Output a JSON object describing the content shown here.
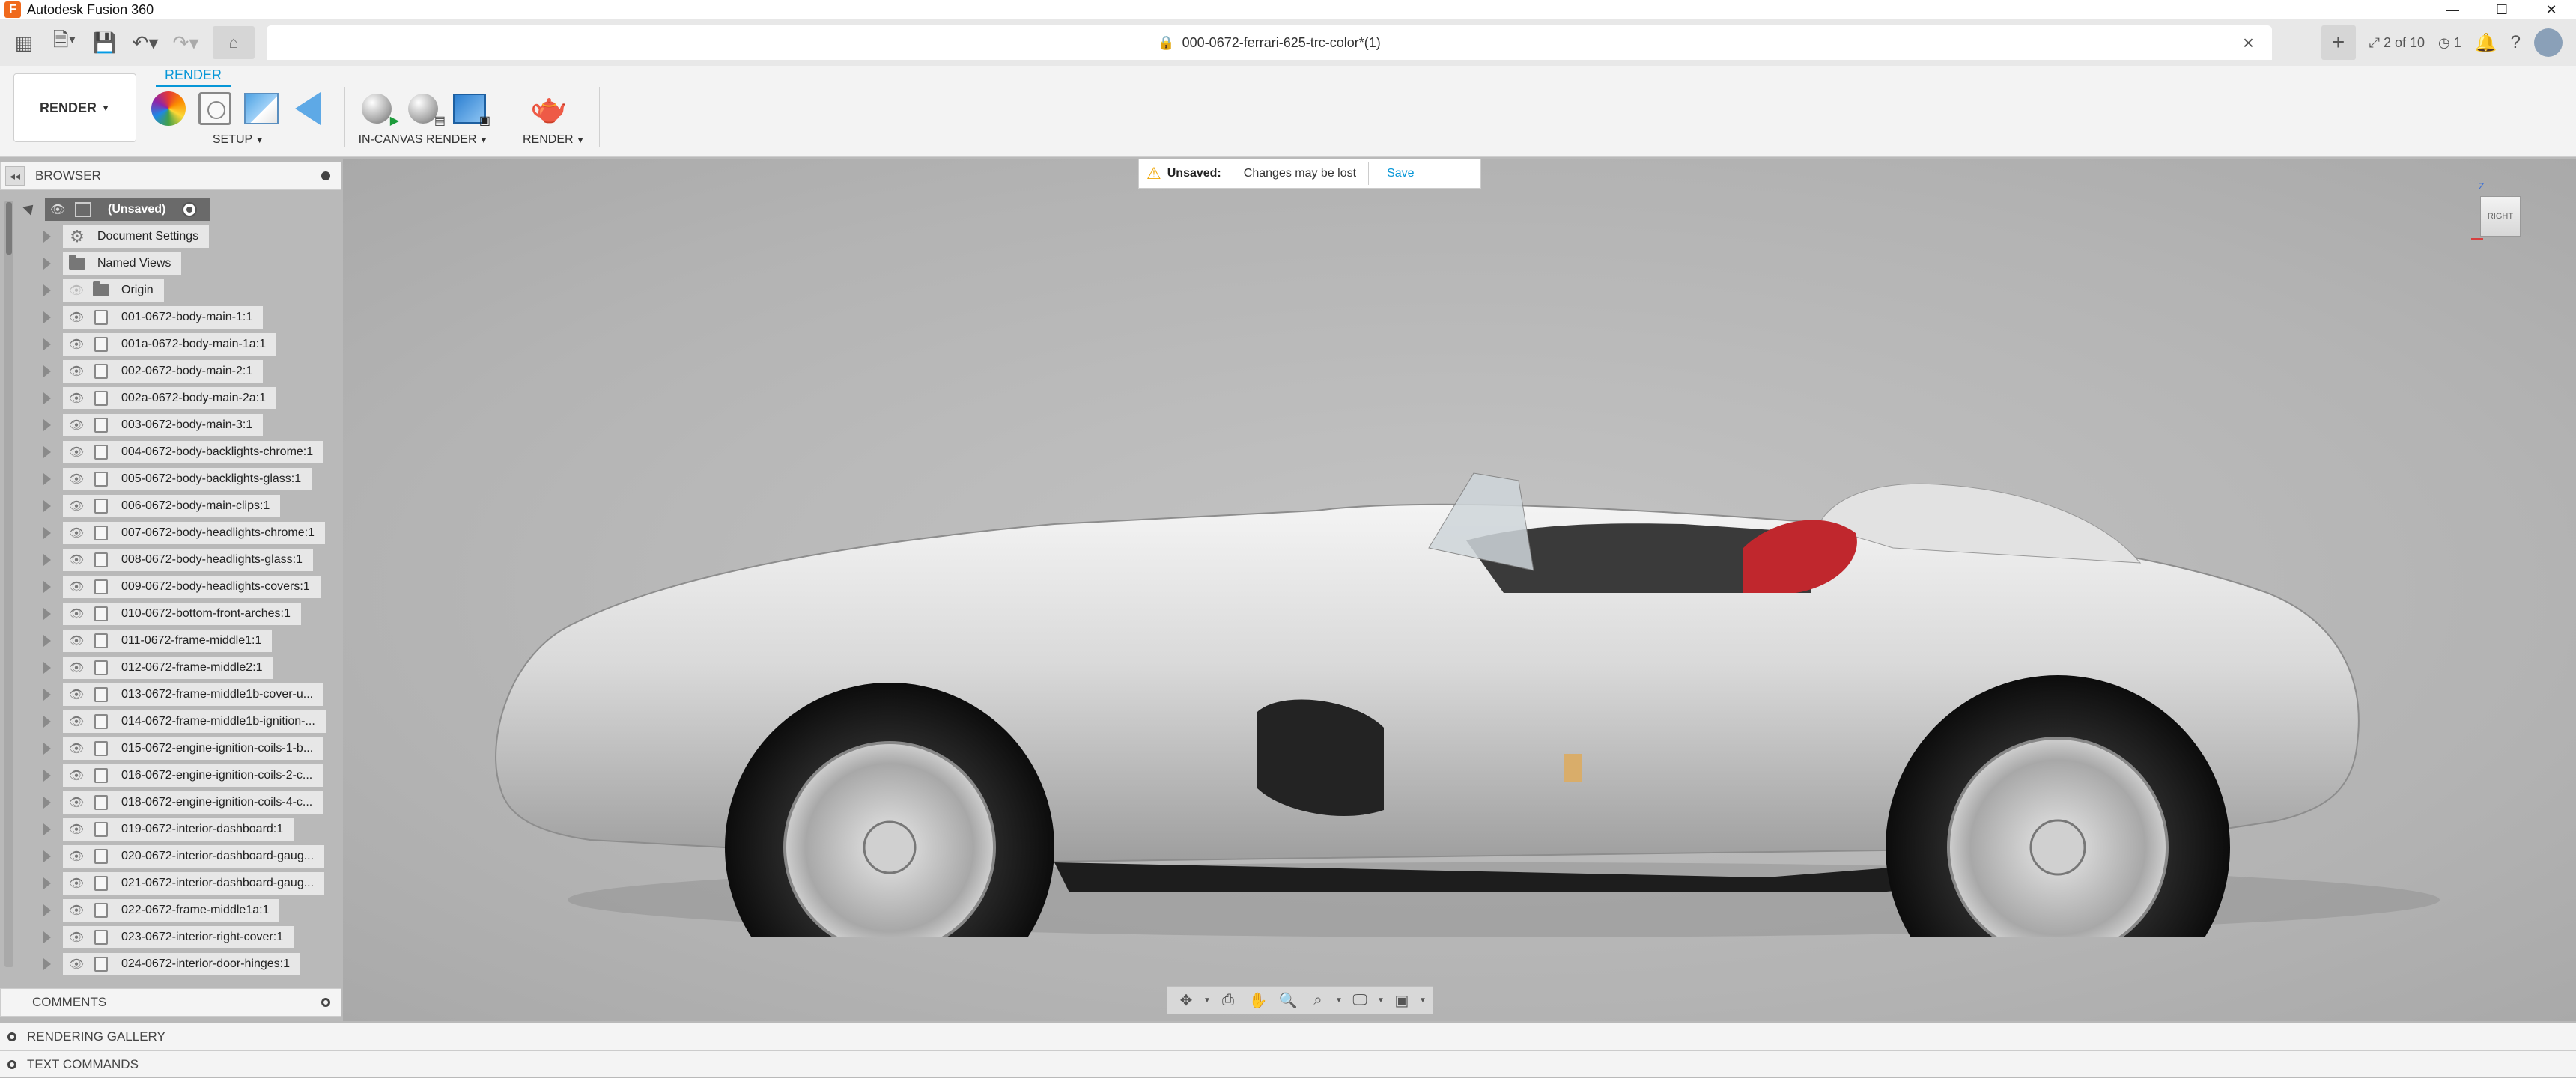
{
  "app": {
    "title": "Autodesk Fusion 360",
    "window_buttons": [
      "—",
      "☐",
      "✕"
    ]
  },
  "quick_access": {
    "doc_title": "000-0672-ferrari-625-trc-color*(1)",
    "jobs": "2 of 10",
    "notifications": "1"
  },
  "ribbon": {
    "workspace": "RENDER",
    "active_tab": "RENDER",
    "groups": {
      "setup": "SETUP",
      "incanvas": "IN-CANVAS RENDER",
      "render": "RENDER"
    }
  },
  "browser": {
    "title": "BROWSER",
    "root": "(Unsaved)",
    "items": [
      {
        "label": "Document Settings",
        "icon": "gear-icon"
      },
      {
        "label": "Named Views",
        "icon": "folder-icon"
      },
      {
        "label": "Origin",
        "icon": "folder-icon"
      },
      {
        "label": "001-0672-body-main-1:1",
        "icon": "component-icon"
      },
      {
        "label": "001a-0672-body-main-1a:1",
        "icon": "component-icon"
      },
      {
        "label": "002-0672-body-main-2:1",
        "icon": "component-icon"
      },
      {
        "label": "002a-0672-body-main-2a:1",
        "icon": "component-icon"
      },
      {
        "label": "003-0672-body-main-3:1",
        "icon": "component-icon"
      },
      {
        "label": "004-0672-body-backlights-chrome:1",
        "icon": "component-icon"
      },
      {
        "label": "005-0672-body-backlights-glass:1",
        "icon": "component-icon"
      },
      {
        "label": "006-0672-body-main-clips:1",
        "icon": "component-icon"
      },
      {
        "label": "007-0672-body-headlights-chrome:1",
        "icon": "component-icon"
      },
      {
        "label": "008-0672-body-headlights-glass:1",
        "icon": "component-icon"
      },
      {
        "label": "009-0672-body-headlights-covers:1",
        "icon": "component-icon"
      },
      {
        "label": "010-0672-bottom-front-arches:1",
        "icon": "component-icon"
      },
      {
        "label": "011-0672-frame-middle1:1",
        "icon": "component-icon"
      },
      {
        "label": "012-0672-frame-middle2:1",
        "icon": "component-icon"
      },
      {
        "label": "013-0672-frame-middle1b-cover-u...",
        "icon": "component-icon"
      },
      {
        "label": "014-0672-frame-middle1b-ignition-...",
        "icon": "component-icon"
      },
      {
        "label": "015-0672-engine-ignition-coils-1-b...",
        "icon": "component-icon"
      },
      {
        "label": "016-0672-engine-ignition-coils-2-c...",
        "icon": "component-icon"
      },
      {
        "label": "018-0672-engine-ignition-coils-4-c...",
        "icon": "component-icon"
      },
      {
        "label": "019-0672-interior-dashboard:1",
        "icon": "component-icon"
      },
      {
        "label": "020-0672-interior-dashboard-gaug...",
        "icon": "component-icon"
      },
      {
        "label": "021-0672-interior-dashboard-gaug...",
        "icon": "component-icon"
      },
      {
        "label": "022-0672-frame-middle1a:1",
        "icon": "component-icon"
      },
      {
        "label": "023-0672-interior-right-cover:1",
        "icon": "component-icon"
      },
      {
        "label": "024-0672-interior-door-hinges:1",
        "icon": "component-icon"
      }
    ]
  },
  "comments": {
    "title": "COMMENTS"
  },
  "bottom": {
    "gallery": "RENDERING GALLERY",
    "text_commands": "TEXT COMMANDS"
  },
  "viewport": {
    "unsaved_label": "Unsaved:",
    "unsaved_message": "Changes may be lost",
    "save_label": "Save",
    "viewcube_face": "RIGHT",
    "viewcube_axis": "Z"
  },
  "colors": {
    "accent": "#0696d7",
    "warning": "#f0a500",
    "seat_red": "#c0272d"
  }
}
